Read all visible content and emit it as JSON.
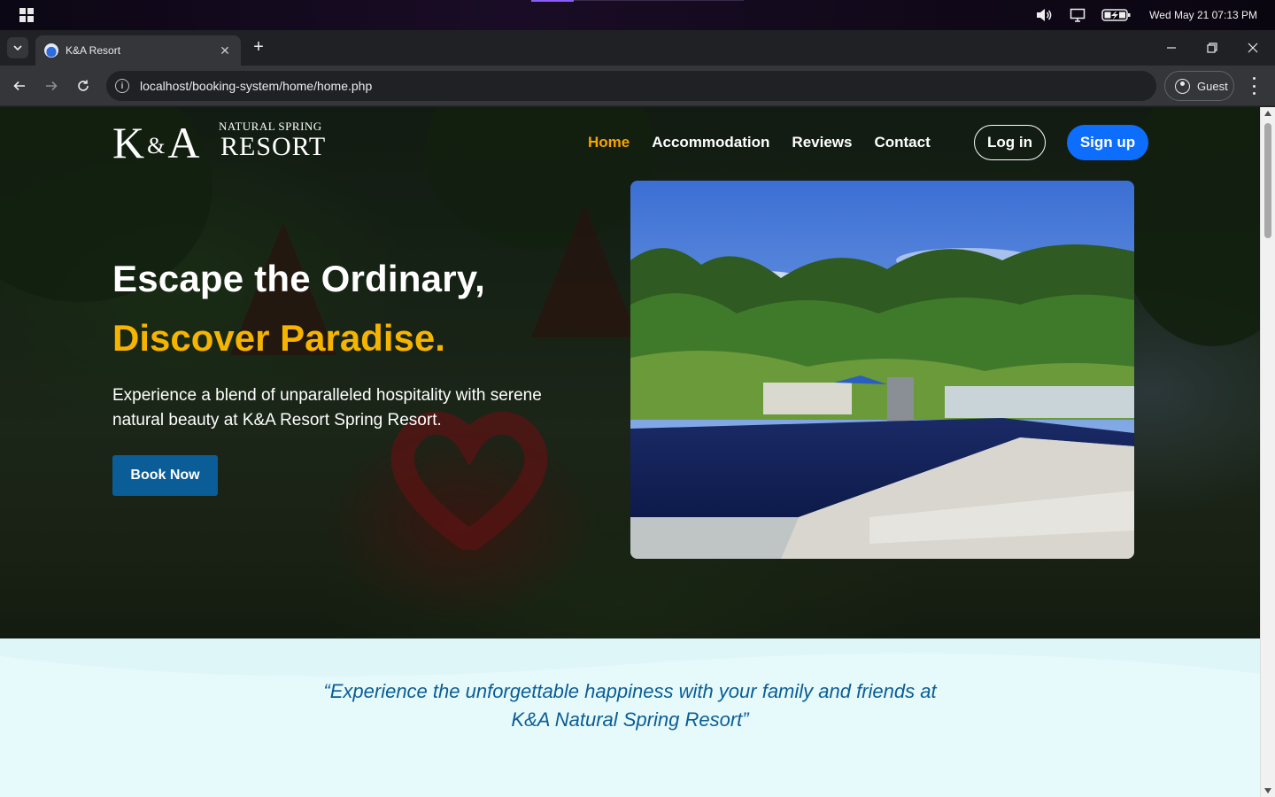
{
  "os": {
    "clock": "Wed May 21  07:13 PM",
    "icons": [
      "windows-start-icon",
      "volume-icon",
      "display-icon",
      "battery-charging-icon"
    ]
  },
  "browser": {
    "tab_title": "K&A Resort",
    "tab_close": "✕",
    "new_tab": "+",
    "url": "localhost/booking-system/home/home.php",
    "profile_label": "Guest"
  },
  "site": {
    "logo": {
      "mark": "K&A",
      "mark_left": "K",
      "mark_amp": "&",
      "mark_right": "A",
      "tagline_top": "NATURAL SPRING",
      "tagline_bottom": "RESORT"
    },
    "nav": {
      "items": [
        {
          "label": "Home",
          "active": true
        },
        {
          "label": "Accommodation",
          "active": false
        },
        {
          "label": "Reviews",
          "active": false
        },
        {
          "label": "Contact",
          "active": false
        }
      ],
      "login_label": "Log in",
      "signup_label": "Sign up"
    },
    "hero": {
      "headline_line1": "Escape the Ordinary,",
      "headline_line2": "Discover Paradise.",
      "lead": "Experience a blend of unparalleled hospitality with serene natural beauty at K&A Resort Spring Resort.",
      "cta_label": "Book Now"
    },
    "quote": {
      "line1": "“Experience the unforgettable happiness with your family and friends at",
      "line2": "K&A Natural Spring Resort”"
    },
    "colors": {
      "accent": "#f5b400",
      "primary_blue": "#0d6efd",
      "cta_blue": "#0a5d96",
      "quote_text": "#0a5d96",
      "quote_bg": "#e6fafc"
    }
  }
}
